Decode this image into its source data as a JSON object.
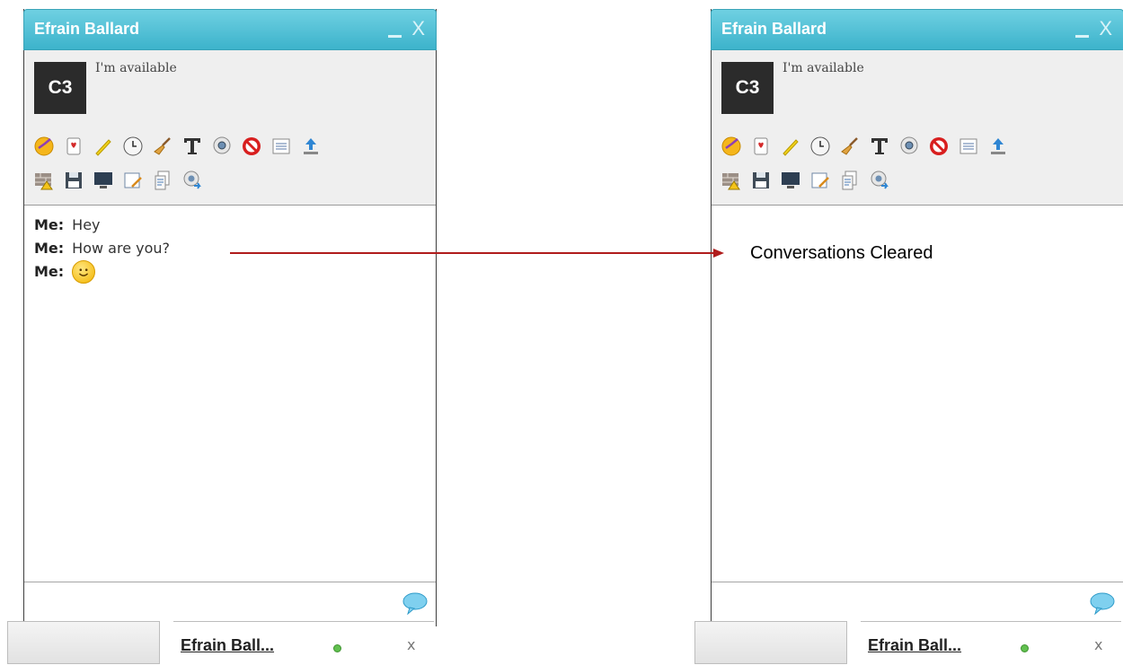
{
  "chat": {
    "title": "Efrain Ballard",
    "close_glyph": "X",
    "avatar_text": "C3",
    "status": "I'm available",
    "me_label": "Me:",
    "messages": [
      "Hey",
      "How are you?"
    ],
    "tab_label": "Efrain Ball...",
    "tab_close": "x"
  },
  "annotation": "Conversations Cleared",
  "toolbar_icons": [
    [
      "emoticon-icon",
      "games-icon",
      "pencil-icon",
      "clock-icon",
      "broom-icon",
      "text-format-icon",
      "webcam-icon",
      "block-icon",
      "list-icon",
      "upload-icon"
    ],
    [
      "warning-wall-icon",
      "save-icon",
      "screen-icon",
      "whiteboard-icon",
      "document-icon",
      "webcam-share-icon"
    ]
  ],
  "colors": {
    "titlebar": "#46bfd6",
    "arrow": "#b01c1c",
    "online": "#61c04f"
  }
}
